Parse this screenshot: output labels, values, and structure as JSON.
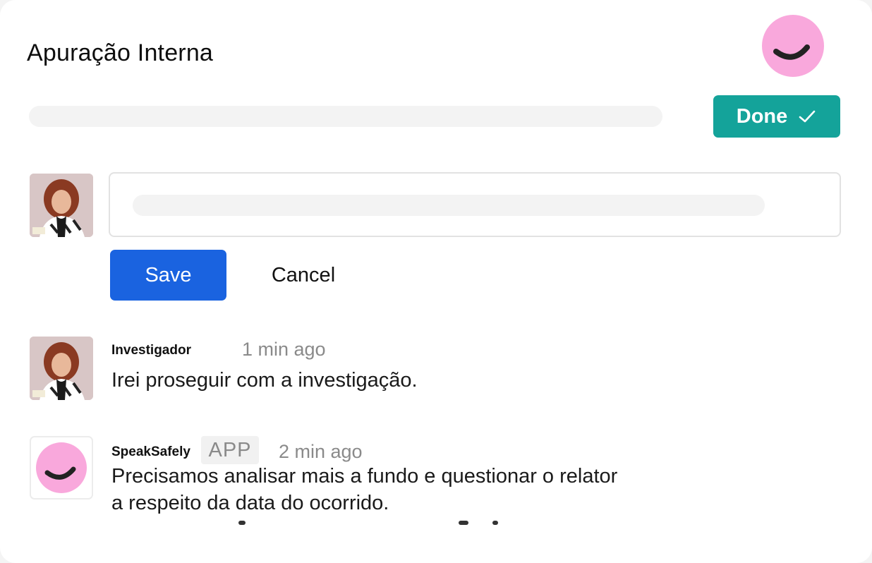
{
  "header": {
    "title": "Apuração Interna",
    "brand_icon": "speaksafely-smile-logo",
    "done_label": "Done",
    "done_icon": "checkmark-icon",
    "accent_color": "#14a39a"
  },
  "editor": {
    "avatar": "user-photo",
    "save_label": "Save",
    "cancel_label": "Cancel",
    "save_color": "#1a63e0"
  },
  "comments": [
    {
      "author": "Investigador",
      "time": "1 min ago",
      "text": "Irei proseguir com a investigação.",
      "avatar": "user-photo"
    },
    {
      "author": "SpeakSafely",
      "badge": "APP",
      "time": "2 min ago",
      "text_line1": "Precisamos analisar mais a fundo e questionar o relator",
      "text_line2": "a respeito da data do ocorrido.",
      "avatar": "speaksafely-smile-logo"
    }
  ],
  "colors": {
    "brand_pink": "#f9a8dc",
    "brand_dark": "#222222"
  }
}
